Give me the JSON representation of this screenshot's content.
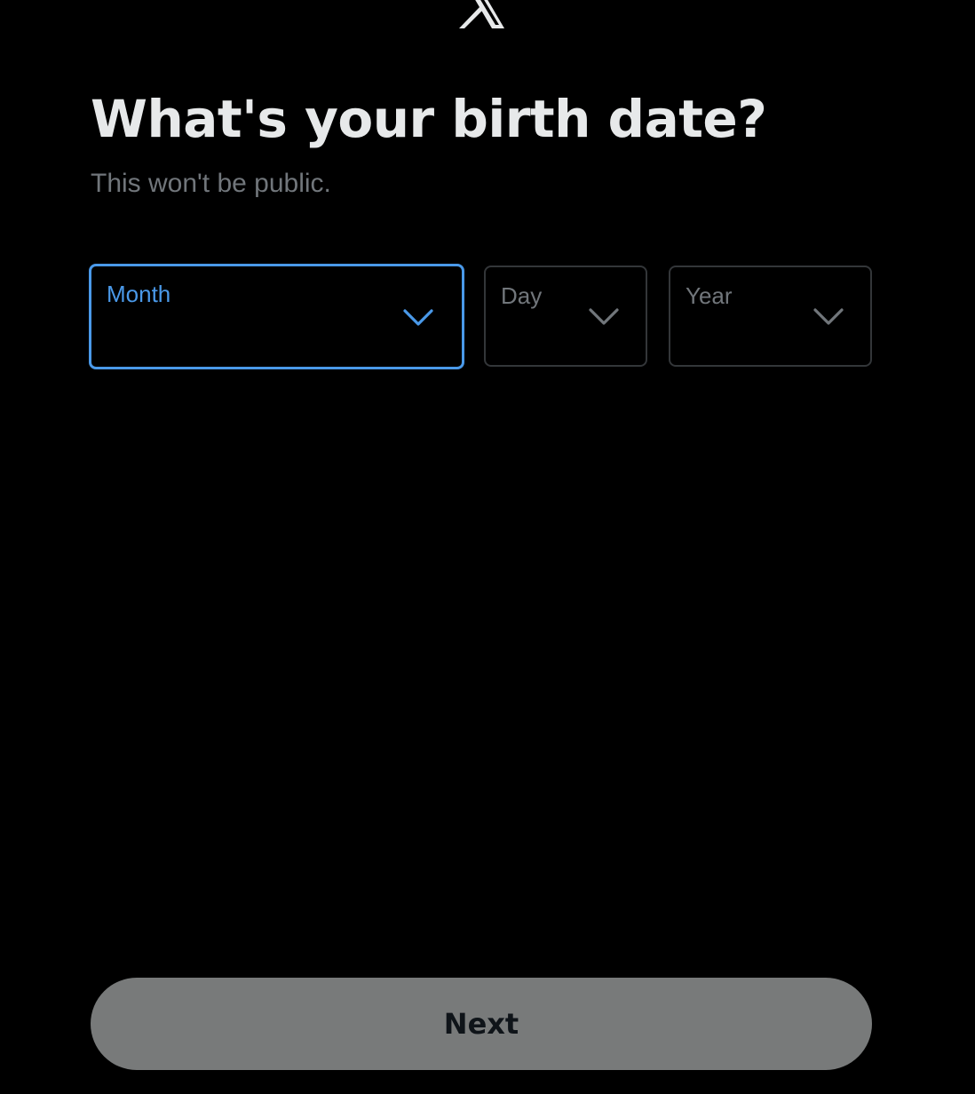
{
  "header": {
    "logo_icon": "x-logo-icon"
  },
  "main": {
    "title": "What's your birth date?",
    "subtitle": "This won't be public."
  },
  "birth_date": {
    "month": {
      "label": "Month",
      "value": "",
      "icon": "chevron-down-icon",
      "focused": true
    },
    "day": {
      "label": "Day",
      "value": "",
      "icon": "chevron-down-icon",
      "focused": false
    },
    "year": {
      "label": "Year",
      "value": "",
      "icon": "chevron-down-icon",
      "focused": false
    }
  },
  "footer": {
    "next_label": "Next",
    "next_enabled": false
  },
  "colors": {
    "background": "#000000",
    "title": "#e7e9ea",
    "subtitle": "#71767b",
    "focus_accent": "#4a99e9",
    "field_border": "#333639",
    "next_button_bg": "#787a7a",
    "next_button_text": "#0f1419"
  }
}
